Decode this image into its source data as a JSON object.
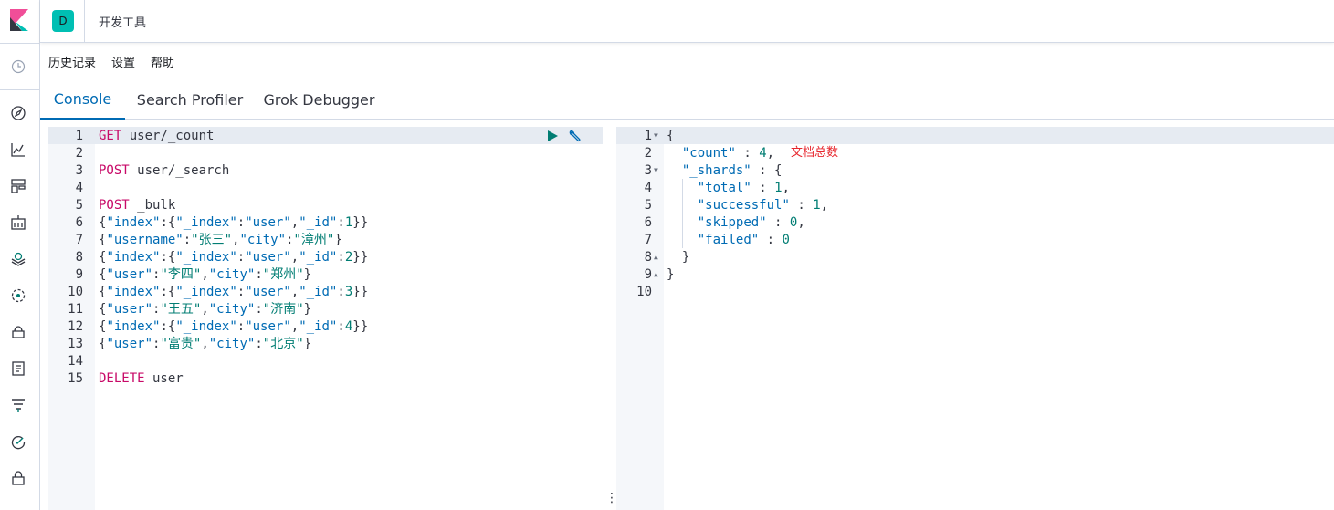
{
  "header": {
    "space_initial": "D",
    "title": "开发工具"
  },
  "menu": {
    "history": "历史记录",
    "settings": "设置",
    "help": "帮助"
  },
  "tabs": [
    {
      "label": "Console",
      "active": true
    },
    {
      "label": "Search Profiler",
      "active": false
    },
    {
      "label": "Grok Debugger",
      "active": false
    }
  ],
  "nav_icons": [
    "clock-icon",
    "compass-icon",
    "visualize-icon",
    "dashboard-icon",
    "canvas-icon",
    "maps-icon",
    "ml-icon",
    "infrastructure-icon",
    "logs-icon",
    "apm-icon",
    "uptime-icon",
    "security-icon"
  ],
  "request": {
    "line_numbers": [
      "1",
      "2",
      "3",
      "4",
      "5",
      "6",
      "7",
      "8",
      "9",
      "10",
      "11",
      "12",
      "13",
      "14",
      "15"
    ],
    "lines": [
      {
        "method": "GET",
        "path": " user/_count",
        "body": ""
      },
      {
        "method": "",
        "path": "",
        "body": ""
      },
      {
        "method": "POST",
        "path": " user/_search",
        "body": ""
      },
      {
        "method": "",
        "path": "",
        "body": ""
      },
      {
        "method": "POST",
        "path": " _bulk",
        "body": ""
      },
      {
        "method": "",
        "path": "",
        "body": "{\"index\":{\"_index\":\"user\",\"_id\":1}}"
      },
      {
        "method": "",
        "path": "",
        "body": "{\"username\":\"张三\",\"city\":\"漳州\"}"
      },
      {
        "method": "",
        "path": "",
        "body": "{\"index\":{\"_index\":\"user\",\"_id\":2}}"
      },
      {
        "method": "",
        "path": "",
        "body": "{\"user\":\"李四\",\"city\":\"郑州\"}"
      },
      {
        "method": "",
        "path": "",
        "body": "{\"index\":{\"_index\":\"user\",\"_id\":3}}"
      },
      {
        "method": "",
        "path": "",
        "body": "{\"user\":\"王五\",\"city\":\"济南\"}"
      },
      {
        "method": "",
        "path": "",
        "body": "{\"index\":{\"_index\":\"user\",\"_id\":4}}"
      },
      {
        "method": "",
        "path": "",
        "body": "{\"user\":\"富贵\",\"city\":\"北京\"}"
      },
      {
        "method": "",
        "path": "",
        "body": ""
      },
      {
        "method": "DELETE",
        "path": " user",
        "body": ""
      }
    ]
  },
  "response": {
    "line_numbers": [
      "1",
      "2",
      "3",
      "4",
      "5",
      "6",
      "7",
      "8",
      "9",
      "10"
    ],
    "lines": [
      "{",
      "  \"count\" : 4,",
      "  \"_shards\" : {",
      "    \"total\" : 1,",
      "    \"successful\" : 1,",
      "    \"skipped\" : 0,",
      "    \"failed\" : 0",
      "  }",
      "}",
      ""
    ],
    "annotation": "文档总数"
  },
  "colors": {
    "accent": "#006bb4",
    "method": "#c80a68",
    "string_value": "#017d73",
    "annotation": "#e7262d",
    "badge": "#00bfb3"
  }
}
